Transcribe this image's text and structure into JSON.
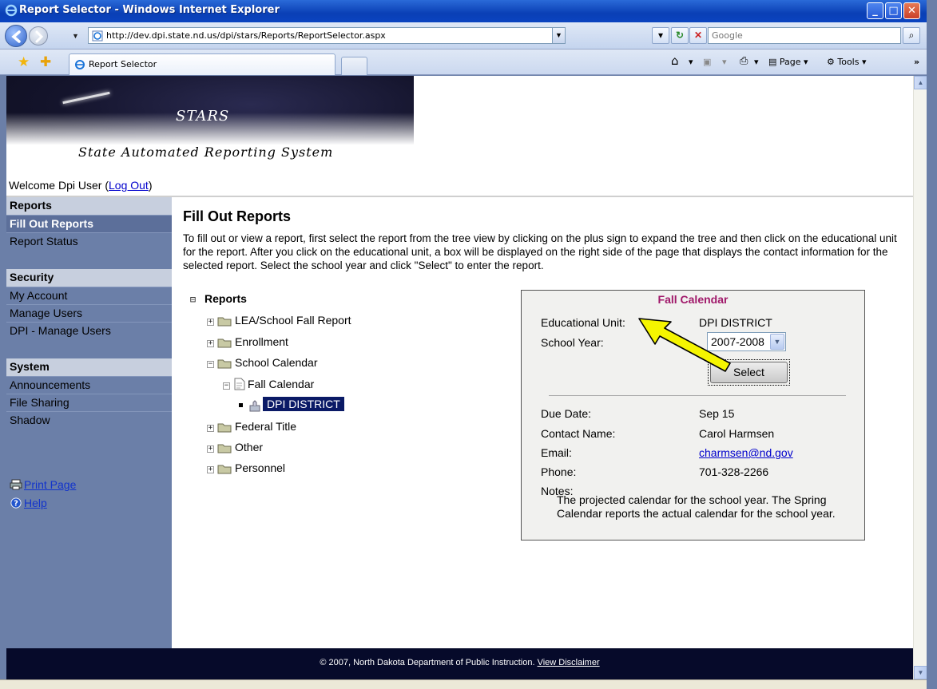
{
  "window": {
    "title": "Report Selector - Windows Internet Explorer",
    "url": "http://dev.dpi.state.nd.us/dpi/stars/Reports/ReportSelector.aspx",
    "search_placeholder": "Google",
    "tab_label": "Report Selector",
    "cmd_page": "Page",
    "cmd_tools": "Tools"
  },
  "header": {
    "brand": "STARS",
    "tagline": "State Automated Reporting System",
    "welcome": "Welcome Dpi User (",
    "logout": "Log Out",
    "welcome_end": ")"
  },
  "sidebar": {
    "reports_heading": "Reports",
    "reports_items": [
      "Fill Out Reports",
      "Report Status"
    ],
    "security_heading": "Security",
    "security_items": [
      "My Account",
      "Manage Users",
      "DPI - Manage Users"
    ],
    "system_heading": "System",
    "system_items": [
      "Announcements",
      "File Sharing",
      "Shadow"
    ],
    "print": "Print Page",
    "help": "Help"
  },
  "main": {
    "title": "Fill Out Reports",
    "intro": "To fill out or view a report, first select the report from the tree view by clicking on the plus sign to expand the tree and then click on the educational unit for the report. After you click on the educational unit, a box will be displayed on the right side of the page that displays the contact information for the selected report. Select the school year and click \"Select\" to enter the report."
  },
  "tree": {
    "root": "Reports",
    "items": [
      "LEA/School Fall Report",
      "Enrollment",
      "School Calendar",
      "Fall Calendar",
      "DPI DISTRICT",
      "Federal Title",
      "Other",
      "Personnel"
    ]
  },
  "panel": {
    "title": "Fall Calendar",
    "edu_unit_label": "Educational Unit:",
    "edu_unit_value": "DPI DISTRICT",
    "school_year_label": "School Year:",
    "school_year_value": "2007-2008",
    "select_button": "Select",
    "due_label": "Due Date:",
    "due_value": "Sep 15",
    "contact_label": "Contact Name:",
    "contact_value": "Carol Harmsen",
    "email_label": "Email:",
    "email_value": "charmsen@nd.gov",
    "phone_label": "Phone:",
    "phone_value": "701-328-2266",
    "notes_label": "Notes:",
    "notes_value": "The projected calendar for the school year. The Spring Calendar reports the actual calendar for the school year."
  },
  "footer": {
    "text": "© 2007, North Dakota Department of Public Instruction. ",
    "link": "View Disclaimer"
  },
  "colors": {
    "sidebar_bg": "#6b7fa8",
    "panel_title": "#a0186a",
    "footer_bg": "#060a2a",
    "selected_node": "#0a1a66",
    "arrow": "#f5f500"
  }
}
